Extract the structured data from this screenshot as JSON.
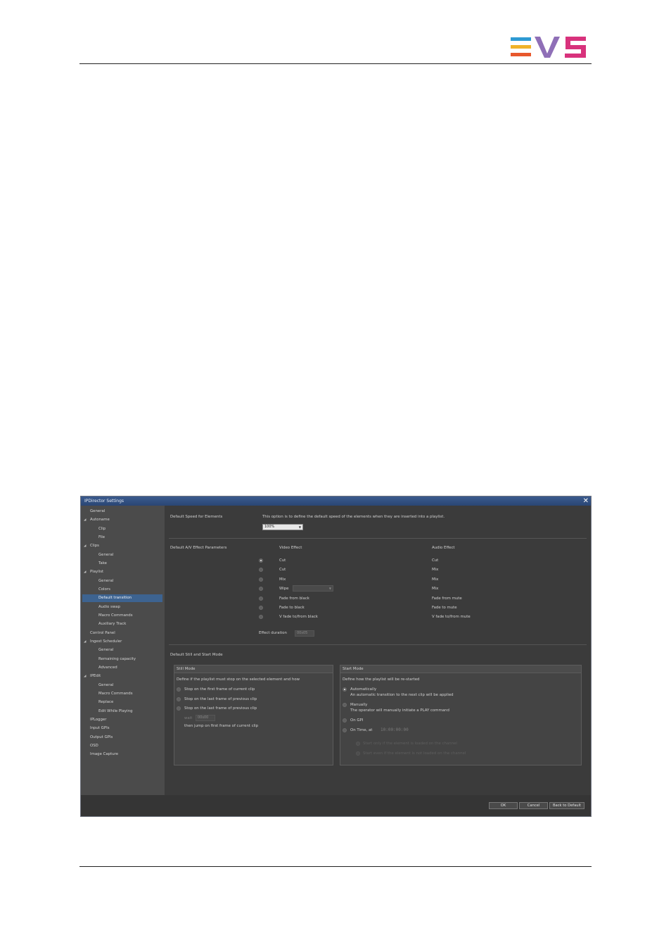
{
  "dialog": {
    "title": "IPDirector Settings",
    "close_glyph": "✕"
  },
  "sidebar": {
    "items": [
      {
        "label": "General",
        "level": 0,
        "expander": false
      },
      {
        "label": "Autoname",
        "level": 0,
        "expander": true
      },
      {
        "label": "Clip",
        "level": 1,
        "expander": false
      },
      {
        "label": "File",
        "level": 1,
        "expander": false
      },
      {
        "label": "Clips",
        "level": 0,
        "expander": true
      },
      {
        "label": "General",
        "level": 1,
        "expander": false
      },
      {
        "label": "Take",
        "level": 1,
        "expander": false
      },
      {
        "label": "Playlist",
        "level": 0,
        "expander": true
      },
      {
        "label": "General",
        "level": 1,
        "expander": false
      },
      {
        "label": "Colors",
        "level": 1,
        "expander": false
      },
      {
        "label": "Default transition",
        "level": 1,
        "expander": false,
        "selected": true
      },
      {
        "label": "Audio swap",
        "level": 1,
        "expander": false
      },
      {
        "label": "Macro Commands",
        "level": 1,
        "expander": false
      },
      {
        "label": "Auxiliary Track",
        "level": 1,
        "expander": false
      },
      {
        "label": "Control Panel",
        "level": 0,
        "expander": false
      },
      {
        "label": "Ingest Scheduler",
        "level": 0,
        "expander": true
      },
      {
        "label": "General",
        "level": 1,
        "expander": false
      },
      {
        "label": "Remaining capacity",
        "level": 1,
        "expander": false
      },
      {
        "label": "Advanced",
        "level": 1,
        "expander": false
      },
      {
        "label": "IPEdit",
        "level": 0,
        "expander": true
      },
      {
        "label": "General",
        "level": 1,
        "expander": false
      },
      {
        "label": "Macro Commands",
        "level": 1,
        "expander": false
      },
      {
        "label": "Replace",
        "level": 1,
        "expander": false
      },
      {
        "label": "Edit While Playing",
        "level": 1,
        "expander": false
      },
      {
        "label": "IPLogger",
        "level": 0,
        "expander": false
      },
      {
        "label": "Input GPIs",
        "level": 0,
        "expander": false
      },
      {
        "label": "Output GPIs",
        "level": 0,
        "expander": false
      },
      {
        "label": "OSD",
        "level": 0,
        "expander": false
      },
      {
        "label": "Image Capture",
        "level": 0,
        "expander": false
      }
    ]
  },
  "speed": {
    "heading": "Default Speed for Elements",
    "description": "This option is to define the default speed of the elements when they are inserted into a playlist.",
    "value": "100%"
  },
  "effects": {
    "heading": "Default A/V Effect Parameters",
    "video_header": "Video Effect",
    "audio_header": "Audio Effect",
    "rows": [
      {
        "video": "Cut",
        "audio": "Cut",
        "selected": true
      },
      {
        "video": "Cut",
        "audio": "Mix",
        "selected": false
      },
      {
        "video": "Mix",
        "audio": "Mix",
        "selected": false
      },
      {
        "video": "Wipe",
        "audio": "Mix",
        "selected": false,
        "has_combo": true
      },
      {
        "video": "Fade from black",
        "audio": "Fade from mute",
        "selected": false
      },
      {
        "video": "Fade to black",
        "audio": "Fade to mute",
        "selected": false
      },
      {
        "video": "V fade to/from black",
        "audio": "V fade to/from mute",
        "selected": false
      }
    ],
    "duration_label": "Effect duration",
    "duration_value": "00s05"
  },
  "stillstart": {
    "heading": "Default Still and Start Mode",
    "still": {
      "title": "Still Mode",
      "description": "Define if the playlist must stop on the selected element and how",
      "options": [
        "Stop on the first frame of current clip",
        "Stop on the last frame of previous clip",
        "Stop on the last frame of previous clip"
      ],
      "wait_label": "wait",
      "wait_value": "00s00",
      "then_text": "then jump on first frame of current clip"
    },
    "start": {
      "title": "Start Mode",
      "description": "Define how the playlist will be re-started",
      "options": [
        {
          "label": "Automatically",
          "sub": "An automatic transition to the next clip will be applied",
          "selected": true
        },
        {
          "label": "Manually",
          "sub": "The operator will manually initiate a PLAY command",
          "selected": false
        },
        {
          "label": "On GPI",
          "sub": "",
          "selected": false
        },
        {
          "label": "On Time, at",
          "sub": "",
          "selected": false
        }
      ],
      "time_value": "10:00:00:00",
      "sub_options": [
        "Start only if the element is loaded on the channel",
        "Start even if the element is not loaded on the channel"
      ]
    }
  },
  "buttons": {
    "ok": "OK",
    "cancel": "Cancel",
    "default": "Back to Default"
  }
}
